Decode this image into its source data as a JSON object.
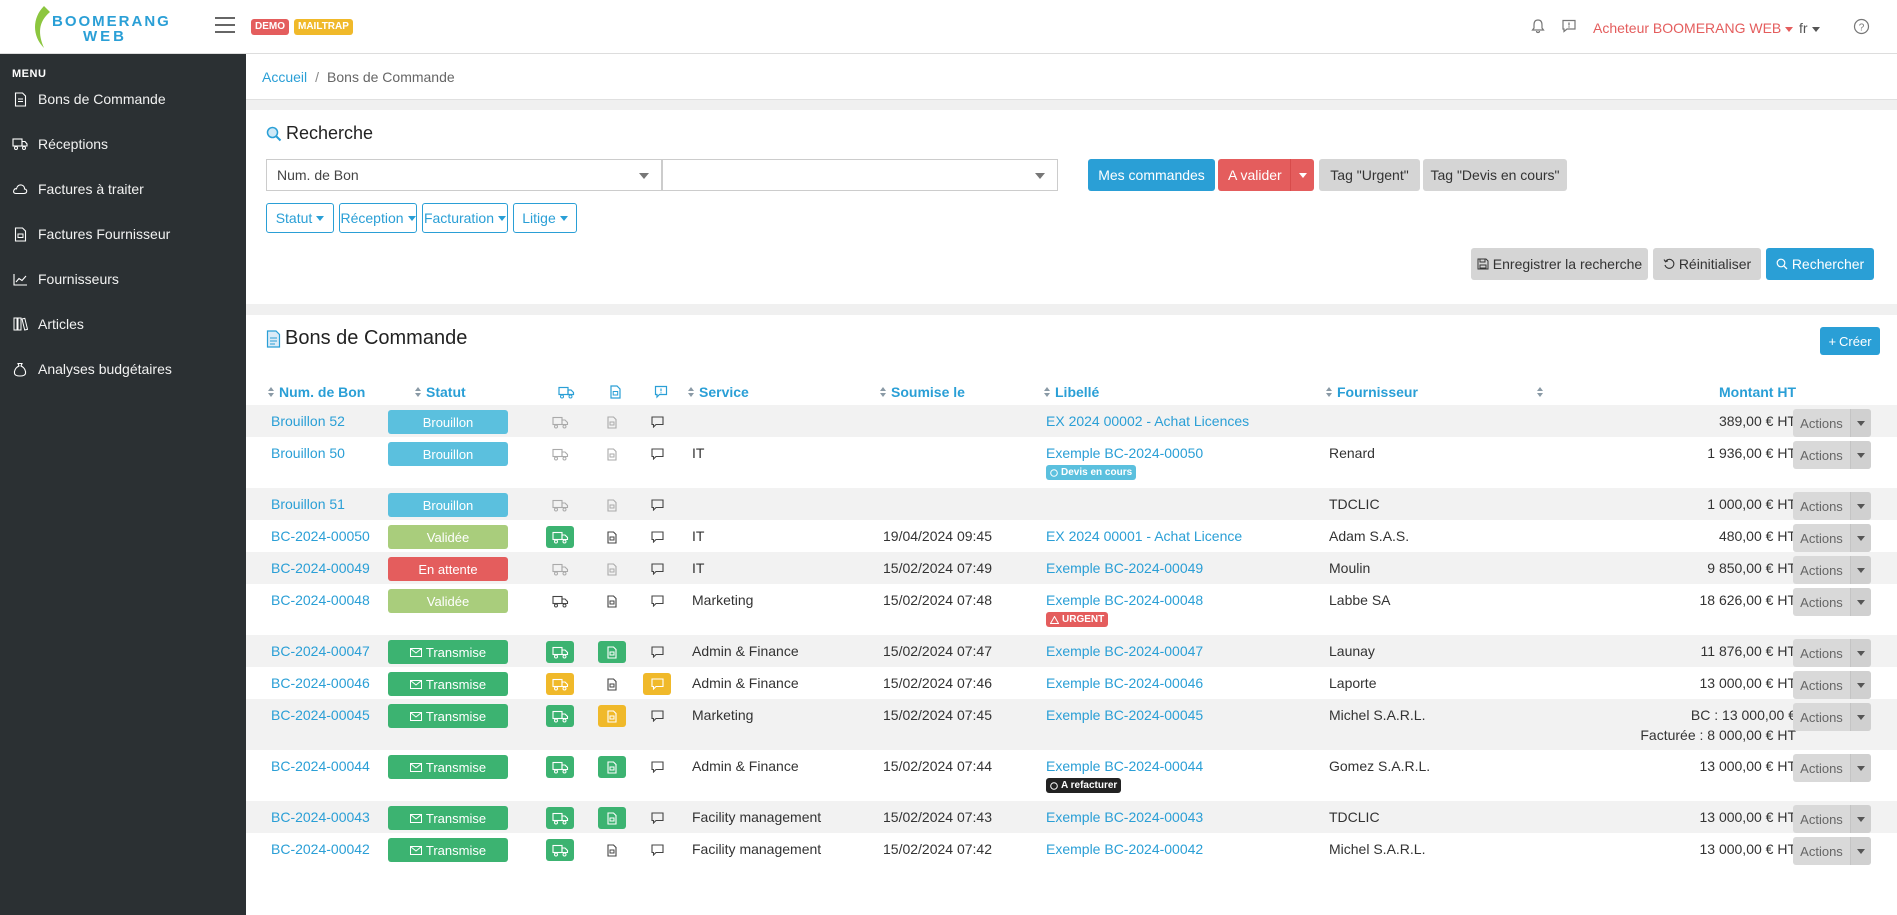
{
  "header": {
    "logo_line1": "BOOMERANG",
    "logo_line2": "WEB",
    "badges": [
      {
        "label": "DEMO",
        "color": "#e45d5d"
      },
      {
        "label": "MAILTRAP",
        "color": "#f0b92a"
      }
    ],
    "user": "Acheteur BOOMERANG WEB",
    "lang": "fr"
  },
  "sidebar": {
    "title": "MENU",
    "items": [
      {
        "label": "Bons de Commande",
        "icon": "document-icon"
      },
      {
        "label": "Réceptions",
        "icon": "truck-icon"
      },
      {
        "label": "Factures à traiter",
        "icon": "cloud-icon"
      },
      {
        "label": "Factures Fournisseur",
        "icon": "invoice-icon"
      },
      {
        "label": "Fournisseurs",
        "icon": "chart-icon"
      },
      {
        "label": "Articles",
        "icon": "books-icon"
      },
      {
        "label": "Analyses budgétaires",
        "icon": "bag-icon"
      }
    ]
  },
  "breadcrumb": {
    "home": "Accueil",
    "current": "Bons de Commande"
  },
  "search": {
    "title": "Recherche",
    "field_select": "Num. de Bon",
    "value_select": "",
    "quick_buttons": {
      "mine": "Mes commandes",
      "to_validate": "A valider",
      "urgent": "Tag \"Urgent\"",
      "quote": "Tag \"Devis en cours\""
    },
    "filters": [
      "Statut",
      "Réception",
      "Facturation",
      "Litige"
    ],
    "save": "Enregistrer la recherche",
    "reset": "Réinitialiser",
    "submit": "Rechercher"
  },
  "orders": {
    "title": "Bons de Commande",
    "create": "Créer",
    "headers": {
      "num": "Num. de Bon",
      "status": "Statut",
      "service": "Service",
      "submitted": "Soumise le",
      "label": "Libellé",
      "supplier": "Fournisseur",
      "amount": "Montant HT"
    },
    "actions_label": "Actions",
    "rows": [
      {
        "num": "Brouillon 52",
        "status": "Brouillon",
        "service": "",
        "date": "",
        "label": "EX 2024 00002 - Achat Licences",
        "tag": "",
        "supplier": "",
        "amount": "389,00 € HT",
        "amount2": ""
      },
      {
        "num": "Brouillon 50",
        "status": "Brouillon",
        "service": "IT",
        "date": "",
        "label": "Exemple BC-2024-00050",
        "tag": "Devis en cours",
        "supplier": "Renard",
        "amount": "1 936,00 € HT",
        "amount2": ""
      },
      {
        "num": "Brouillon 51",
        "status": "Brouillon",
        "service": "",
        "date": "",
        "label": "",
        "tag": "",
        "supplier": "TDCLIC",
        "amount": "1 000,00 € HT",
        "amount2": ""
      },
      {
        "num": "BC-2024-00050",
        "status": "Validée",
        "service": "IT",
        "date": "19/04/2024 09:45",
        "label": "EX 2024 00001 - Achat Licence",
        "tag": "",
        "supplier": "Adam S.A.S.",
        "amount": "480,00 € HT",
        "amount2": ""
      },
      {
        "num": "BC-2024-00049",
        "status": "En attente",
        "service": "IT",
        "date": "15/02/2024 07:49",
        "label": "Exemple BC-2024-00049",
        "tag": "",
        "supplier": "Moulin",
        "amount": "9 850,00 € HT",
        "amount2": ""
      },
      {
        "num": "BC-2024-00048",
        "status": "Validée",
        "service": "Marketing",
        "date": "15/02/2024 07:48",
        "label": "Exemple BC-2024-00048",
        "tag": "URGENT",
        "supplier": "Labbe SA",
        "amount": "18 626,00 € HT",
        "amount2": ""
      },
      {
        "num": "BC-2024-00047",
        "status": "Transmise",
        "service": "Admin & Finance",
        "date": "15/02/2024 07:47",
        "label": "Exemple BC-2024-00047",
        "tag": "",
        "supplier": "Launay",
        "amount": "11 876,00 € HT",
        "amount2": ""
      },
      {
        "num": "BC-2024-00046",
        "status": "Transmise",
        "service": "Admin & Finance",
        "date": "15/02/2024 07:46",
        "label": "Exemple BC-2024-00046",
        "tag": "",
        "supplier": "Laporte",
        "amount": "13 000,00 € HT",
        "amount2": ""
      },
      {
        "num": "BC-2024-00045",
        "status": "Transmise",
        "service": "Marketing",
        "date": "15/02/2024 07:45",
        "label": "Exemple BC-2024-00045",
        "tag": "",
        "supplier": "Michel S.A.R.L.",
        "amount": "BC : 13 000,00 €",
        "amount2": "Facturée : 8 000,00 € HT"
      },
      {
        "num": "BC-2024-00044",
        "status": "Transmise",
        "service": "Admin & Finance",
        "date": "15/02/2024 07:44",
        "label": "Exemple BC-2024-00044",
        "tag": "A refacturer",
        "supplier": "Gomez S.A.R.L.",
        "amount": "13 000,00 € HT",
        "amount2": ""
      },
      {
        "num": "BC-2024-00043",
        "status": "Transmise",
        "service": "Facility management",
        "date": "15/02/2024 07:43",
        "label": "Exemple BC-2024-00043",
        "tag": "",
        "supplier": "TDCLIC",
        "amount": "13 000,00 € HT",
        "amount2": ""
      },
      {
        "num": "BC-2024-00042",
        "status": "Transmise",
        "service": "Facility management",
        "date": "15/02/2024 07:42",
        "label": "Exemple BC-2024-00042",
        "tag": "",
        "supplier": "Michel S.A.R.L.",
        "amount": "13 000,00 € HT",
        "amount2": ""
      }
    ]
  },
  "colors": {
    "accent": "#2a9fd6",
    "danger": "#e45d5d",
    "warning": "#f0b92a",
    "success": "#3cb371",
    "draft": "#5bc0de",
    "validated": "#a9cd7c",
    "sidebar": "#2b3033"
  }
}
